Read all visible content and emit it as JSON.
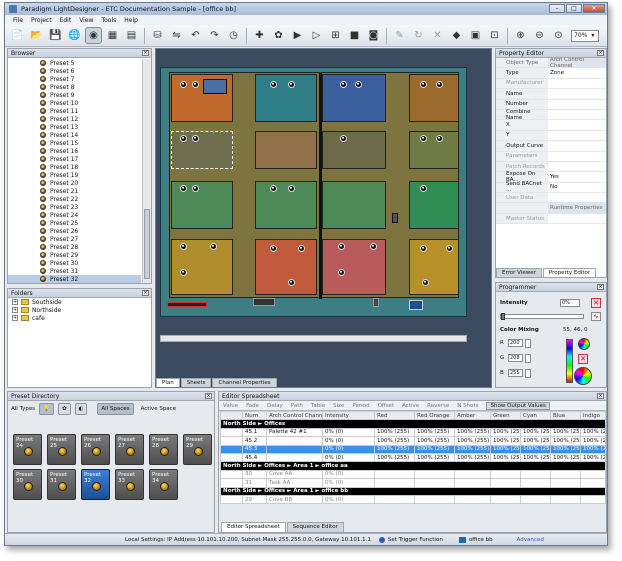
{
  "window": {
    "title": "Paradigm LightDesigner - ETC Documentation Sample - [office bb]"
  },
  "menu": [
    "File",
    "Project",
    "Edit",
    "View",
    "Tools",
    "Help"
  ],
  "toolbar": {
    "zoom": "70%"
  },
  "browser": {
    "title": "Browser",
    "items": [
      "Preset 5",
      "Preset 6",
      "Preset 7",
      "Preset 8",
      "Preset 9",
      "Preset 10",
      "Preset 11",
      "Preset 12",
      "Preset 13",
      "Preset 14",
      "Preset 15",
      "Preset 16",
      "Preset 17",
      "Preset 18",
      "Preset 19",
      "Preset 20",
      "Preset 21",
      "Preset 22",
      "Preset 23",
      "Preset 24",
      "Preset 25",
      "Preset 26",
      "Preset 27",
      "Preset 28",
      "Preset 29",
      "Preset 30",
      "Preset 31",
      "Preset 32"
    ],
    "selected": "Preset 32"
  },
  "folders": {
    "title": "Folders",
    "items": [
      "Southside",
      "Northside",
      "cafe"
    ]
  },
  "center_tabs": [
    "Plan",
    "Sheets",
    "Channel Properties"
  ],
  "property_editor": {
    "title": "Property Editor",
    "rows": [
      {
        "k": "Object Type",
        "v": "Arch Control Channel",
        "style": "hdr"
      },
      {
        "k": "Type",
        "v": "Zone"
      },
      {
        "k": "Manufacturer",
        "v": "",
        "style": "dim"
      },
      {
        "k": "Name",
        "v": ""
      },
      {
        "k": "Number",
        "v": ""
      },
      {
        "k": "Combine Name",
        "v": ""
      },
      {
        "k": "X",
        "v": ""
      },
      {
        "k": "Y",
        "v": ""
      },
      {
        "k": "Output Curve",
        "v": ""
      },
      {
        "k": "Parameters",
        "v": "",
        "style": "dim"
      },
      {
        "k": "Patch Records",
        "v": "",
        "style": "dim"
      },
      {
        "k": "Expose On BA...",
        "v": "Yes"
      },
      {
        "k": "Send BACnet ...",
        "v": "No"
      },
      {
        "k": "User Data",
        "v": "",
        "style": "dim"
      },
      {
        "k": "",
        "v": "Runtime Properties",
        "style": "hdr"
      },
      {
        "k": "Master Status",
        "v": "",
        "style": "dim"
      }
    ],
    "tabs": [
      "Error Viewer",
      "Property Editor"
    ]
  },
  "programmer": {
    "title": "Programmer",
    "intensity_label": "Intensity",
    "intensity_value": "0%",
    "color_mixing_label": "Color Mixing",
    "color_mixing_value": "55, 46, 0",
    "r_label": "R",
    "r": "200",
    "g_label": "G",
    "g": "208",
    "b_label": "B",
    "b": "255"
  },
  "preset_directory": {
    "title": "Preset Directory",
    "all_types": "All Types",
    "all_spaces": "All Spaces",
    "active_space": "Active Space",
    "tiles": [
      "Preset 24",
      "Preset 25",
      "Preset 26",
      "Preset 27",
      "Preset 28",
      "Preset 29",
      "Preset 30",
      "Preset 31",
      "Preset 32",
      "Preset 33",
      "Preset 34"
    ],
    "selected": "Preset 32"
  },
  "spreadsheet": {
    "title": "Editor Spreadsheet",
    "tabs": [
      "Value",
      "Fade",
      "Delay",
      "Path",
      "Table",
      "Size",
      "Period",
      "Offset",
      "Active",
      "Reverse",
      "N Shots",
      "Show Output Values"
    ],
    "columns": [
      "",
      "Num",
      "Arch Control Channel",
      "Intensity",
      "Red",
      "Red Orange",
      "Amber",
      "Green",
      "Cyan",
      "Blue",
      "Indigo"
    ],
    "rows": [
      {
        "type": "grp",
        "text": "North Side ► Offices"
      },
      {
        "type": "data",
        "cells": [
          "",
          "45.1",
          "Palette 42 #1",
          "0% (0)",
          "100% (255)",
          "100% (255)",
          "100% (255)",
          "100% (255)",
          "100% (255)",
          "100% (255)",
          "100% (255)"
        ]
      },
      {
        "type": "data",
        "cells": [
          "",
          "45.2",
          "",
          "0% (0)",
          "100% (255)",
          "100% (255)",
          "100% (255)",
          "100% (255)",
          "100% (255)",
          "100% (255)",
          "100% (255)"
        ]
      },
      {
        "type": "sel",
        "cells": [
          "",
          "45.3",
          "",
          "0% (0)",
          "100% (255)",
          "100% (255)",
          "100% (255)",
          "100% (255)",
          "100% (255)",
          "100% (255)",
          "100% (255)"
        ]
      },
      {
        "type": "data",
        "cells": [
          "",
          "45.4",
          "",
          "0% (0)",
          "100% (255)",
          "100% (255)",
          "100% (255)",
          "100% (255)",
          "100% (255)",
          "100% (255)",
          "100% (255)"
        ]
      },
      {
        "type": "grp",
        "text": "North Side ► Offices ► Area 1 ► office aa"
      },
      {
        "type": "grey",
        "cells": [
          "",
          "30",
          "Cove AA",
          "0% (0)",
          "",
          "",
          "",
          "",
          "",
          "",
          ""
        ]
      },
      {
        "type": "grey",
        "cells": [
          "",
          "31",
          "Task AA",
          "0% (0)",
          "",
          "",
          "",
          "",
          "",
          "",
          ""
        ]
      },
      {
        "type": "grp",
        "text": "North Side ► Offices ► Area 1 ► office bb"
      },
      {
        "type": "grey",
        "cells": [
          "",
          "29",
          "Cove BB",
          "0% (0)",
          "",
          "",
          "",
          "",
          "",
          "",
          ""
        ]
      }
    ],
    "bottom_tabs": [
      "Editor Spreadsheet",
      "Sequence Editor"
    ]
  },
  "status": {
    "settings": "Local Settings: IP Address 10.101.10.200, Subnet Mask 255.255.0.0, Gateway 10.101.1.1",
    "trigger": "Set Trigger Function",
    "space": "office bb",
    "mode": "Advanced"
  }
}
